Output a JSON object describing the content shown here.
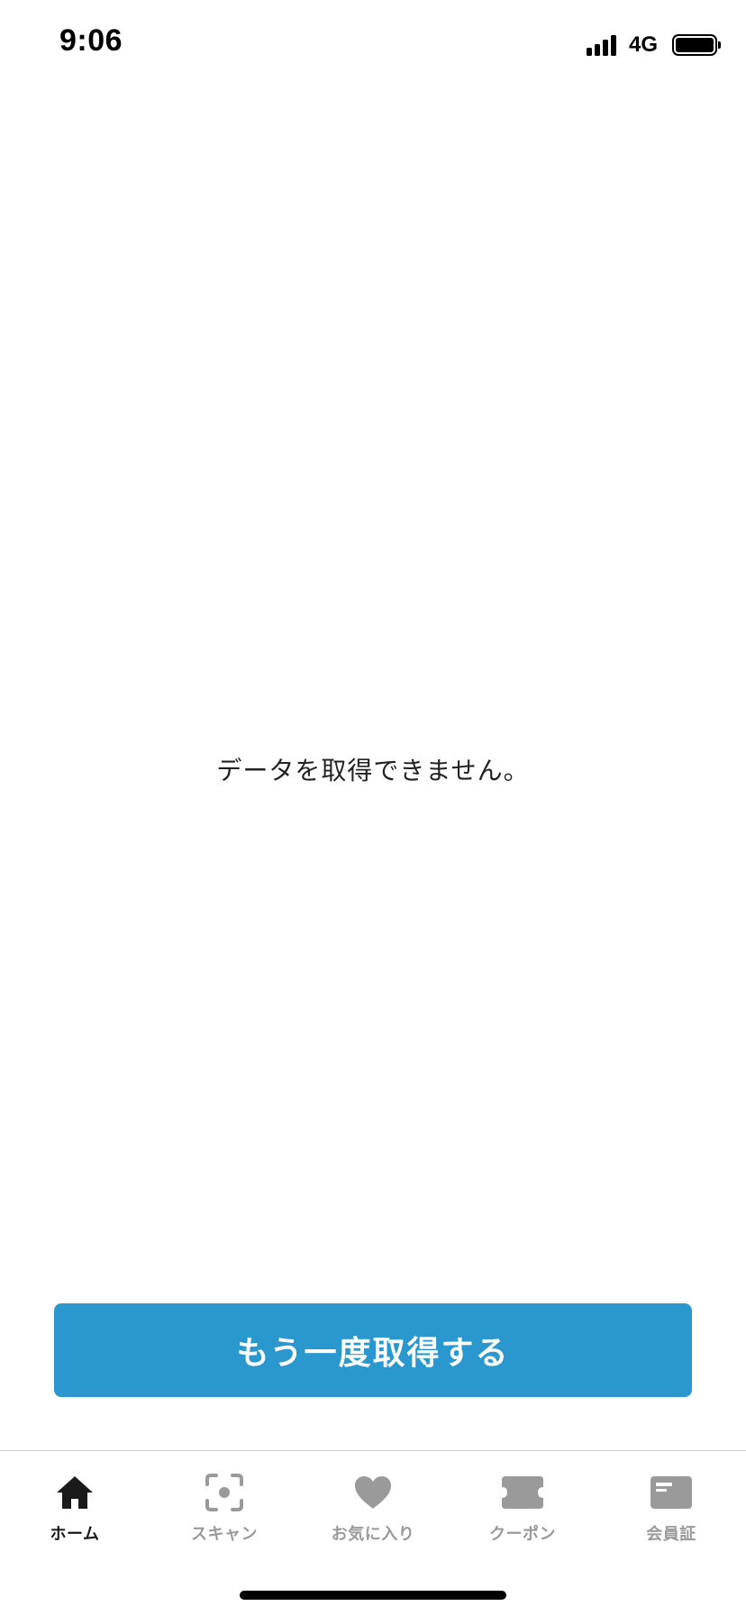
{
  "status_bar": {
    "time": "9:06",
    "network": "4G",
    "signal_icon": "cellular-signal-icon",
    "battery_icon": "battery-icon"
  },
  "main": {
    "message": "データを取得できません。",
    "retry_button_label": "もう一度取得する",
    "retry_button_color": "#2a97cf"
  },
  "tab_bar": {
    "active_color": "#1a1a1a",
    "inactive_color": "#9a9a9a",
    "items": [
      {
        "label": "ホーム",
        "icon": "home-icon",
        "active": true
      },
      {
        "label": "スキャン",
        "icon": "scan-icon",
        "active": false
      },
      {
        "label": "お気に入り",
        "icon": "heart-icon",
        "active": false
      },
      {
        "label": "クーポン",
        "icon": "coupon-icon",
        "active": false
      },
      {
        "label": "会員証",
        "icon": "member-card-icon",
        "active": false
      }
    ]
  }
}
